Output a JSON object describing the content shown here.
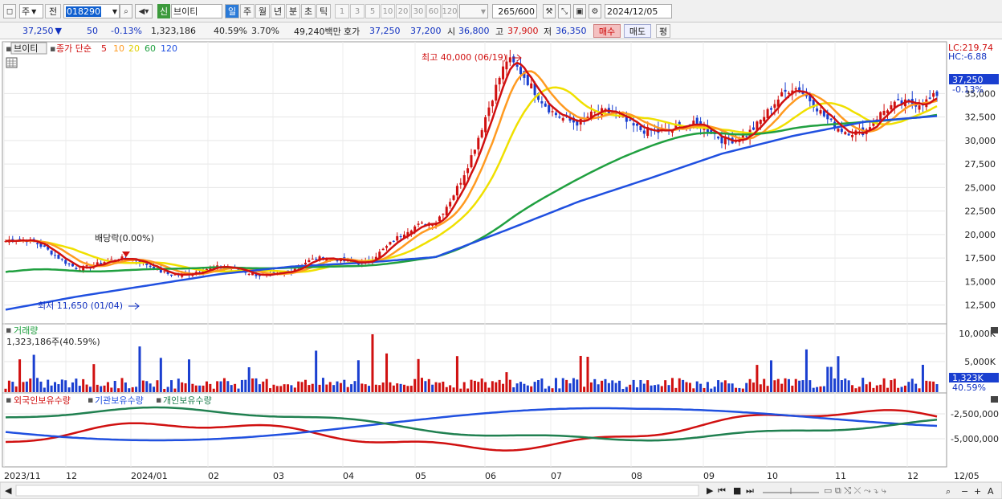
{
  "toolbar": {
    "period_select": "주",
    "prev_label": "전",
    "code_value": "018290",
    "credit_badge": "신",
    "stock_name": "브이티",
    "tabs": [
      "일",
      "주",
      "월",
      "년",
      "분",
      "초",
      "틱"
    ],
    "interval_buttons": [
      "1",
      "3",
      "5",
      "10",
      "20",
      "30",
      "60",
      "120"
    ],
    "count_value": "265",
    "count_total": "/600",
    "date_value": "2024/12/05"
  },
  "quote": {
    "price": "37,250",
    "change": "50",
    "change_pct": "-0.13%",
    "volume": "1,323,186",
    "turnover_pct": "40.59%",
    "rate": "3.70%",
    "amount": "49,240백만",
    "bid_label": "호가",
    "bid1": "37,250",
    "bid2": "37,200",
    "open_label": "시",
    "open": "36,800",
    "high_label": "고",
    "high": "37,900",
    "low_label": "저",
    "low": "36,350",
    "buy_label": "매수",
    "sell_label": "매도",
    "extra_label": "평"
  },
  "price_panel": {
    "stock": "브이티",
    "ma_label": "종가 단순",
    "ma_periods": [
      "5",
      "10",
      "20",
      "60",
      "120"
    ],
    "ma_colors": [
      "#d01010",
      "#ff9a20",
      "#f0e000",
      "#20a040",
      "#2050e0"
    ],
    "lc": "LC:219.74",
    "hc": "HC:-6.88",
    "cur_price": "37,250",
    "cur_change": "-0.13%",
    "high_annot": "최고 40,000 (06/19)",
    "low_annot": "최저 11,650 (01/04)",
    "div_annot": "배당락(0.00%)",
    "y_ticks": [
      "35,000",
      "32,500",
      "30,000",
      "27,500",
      "25,000",
      "22,500",
      "20,000",
      "17,500",
      "15,000",
      "12,500"
    ]
  },
  "volume_panel": {
    "title": "거래량",
    "value_label": "1,323,186주(40.59%)",
    "y_ticks": [
      "10,000K",
      "5,000K"
    ],
    "cur": "1,323K",
    "cur_pct": "40.59%"
  },
  "holding_panel": {
    "legend": [
      "외국인보유수량",
      "기관보유수량",
      "개인보유수량"
    ],
    "colors": [
      "#d01010",
      "#2050e0",
      "#208050"
    ],
    "y_ticks": [
      "-2,500,000",
      "-5,000,000"
    ]
  },
  "x_axis": {
    "labels": [
      "2023/11",
      "12",
      "2024/01",
      "02",
      "03",
      "04",
      "05",
      "06",
      "07",
      "08",
      "09",
      "10",
      "11",
      "12",
      "12/05"
    ]
  },
  "chart_data": {
    "type": "line",
    "title": "브이티",
    "x": [
      "2023/11",
      "12",
      "2024/01",
      "02",
      "03",
      "04",
      "05",
      "06",
      "07",
      "08",
      "09",
      "10",
      "11",
      "12"
    ],
    "series": [
      {
        "name": "5",
        "values": [
          19300,
          16500,
          17000,
          16300,
          15800,
          17500,
          22000,
          37000,
          31000,
          33000,
          30500,
          33500,
          31000,
          37250
        ]
      },
      {
        "name": "120",
        "values": [
          12000,
          13400,
          14600,
          15800,
          16600,
          17000,
          17600,
          20500,
          23500,
          26000,
          28600,
          30500,
          32000,
          32600
        ]
      }
    ],
    "ylim": [
      10500,
      40500
    ],
    "annotations": [
      "최고 40,000 (06/19)",
      "최저 11,650 (01/04)",
      "배당락(0.00%)"
    ]
  }
}
